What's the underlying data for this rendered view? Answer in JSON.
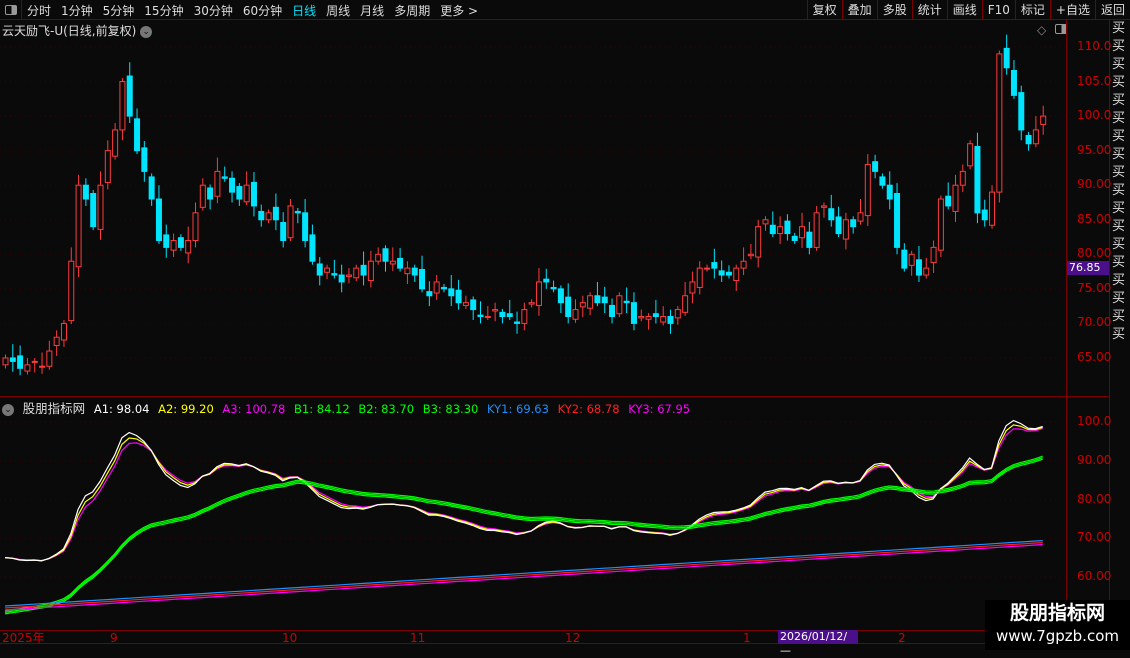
{
  "topbar": {
    "periods": [
      "分时",
      "1分钟",
      "5分钟",
      "15分钟",
      "30分钟",
      "60分钟",
      "日线",
      "周线",
      "月线",
      "多周期",
      "更多 >"
    ],
    "active": "日线",
    "tools": [
      "复权",
      "叠加",
      "多股",
      "统计",
      "画线",
      "F10",
      "标记",
      "+自选",
      "返回"
    ]
  },
  "title": "云天励飞-U(日线,前复权)",
  "price_axis": [
    "110.0",
    "105.0",
    "100.0",
    "95.00",
    "90.00",
    "85.00",
    "80.00",
    "75.00",
    "70.00",
    "65.00"
  ],
  "current_price": "76.85",
  "indicator": {
    "name": "股朋指标网",
    "A1": "A1: 98.04",
    "A2": "A2: 99.20",
    "A3": "A3: 100.78",
    "B1": "B1: 84.12",
    "B2": "B2: 83.70",
    "B3": "B3: 83.30",
    "KY1": "KY1: 69.63",
    "KY2": "KY2: 68.78",
    "KY3": "KY3: 67.95"
  },
  "ind_axis": [
    "100.0",
    "90.00",
    "80.00",
    "70.00",
    "60.00"
  ],
  "x_axis": [
    "2025年",
    "9",
    "10",
    "11",
    "12",
    "1",
    "2"
  ],
  "date_tag": "2026/01/12/—",
  "right_col": "买买买买买买买买买买买买买买买买买买",
  "watermark": {
    "name": "股朋指标网",
    "url": "www.7gpzb.com"
  },
  "colors": {
    "up": "#ff3b3b",
    "down": "#00e5ff",
    "A1": "#ffffff",
    "A2": "#ffff00",
    "A3": "#ff00ff",
    "B": "#00ff00",
    "KY1": "#1e90ff",
    "KY2": "#ff2020",
    "KY3": "#ff00ff"
  },
  "chart_data": {
    "type": "candlestick",
    "closes": [
      65,
      64.5,
      63.5,
      64,
      64.5,
      63.8,
      66,
      68,
      70,
      79,
      90,
      88,
      84,
      90,
      95,
      98,
      105,
      100,
      95,
      92,
      88,
      82,
      81,
      82,
      81,
      82,
      86,
      90,
      88,
      92,
      91,
      89,
      88,
      90,
      87,
      85,
      86,
      85,
      82,
      87,
      86,
      82,
      79,
      77,
      78,
      77,
      76,
      77,
      78,
      77,
      79,
      80,
      79,
      79,
      78,
      78,
      77,
      75,
      74,
      76,
      75,
      74,
      73,
      73,
      72,
      71,
      71,
      72,
      71,
      71,
      70,
      72,
      73,
      76,
      76,
      75,
      73,
      71,
      72,
      73,
      74,
      73,
      73,
      71,
      74,
      73,
      70,
      71,
      71,
      71,
      71,
      70,
      72,
      74,
      76,
      78,
      78,
      78,
      77,
      77,
      78,
      79,
      80,
      84,
      85,
      83,
      84,
      83,
      82,
      84,
      81,
      86,
      87,
      85,
      83,
      85,
      84,
      86,
      93,
      92,
      90,
      88,
      81,
      78,
      80,
      77,
      78,
      81,
      88,
      87,
      90,
      92,
      96,
      86,
      85,
      89,
      109,
      107,
      103,
      98,
      96,
      98,
      100
    ],
    "price_range": [
      61,
      112
    ]
  }
}
